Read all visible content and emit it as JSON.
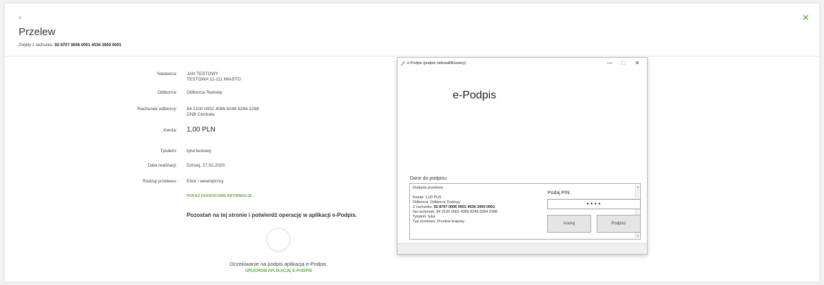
{
  "header": {
    "back_icon": "chevron-left-icon",
    "close_icon": "close-icon",
    "title": "Przelew",
    "sub_prefix": "Zwykły z rachunku",
    "sub_account": "92 8707 0006 0001 4036 3000 0001"
  },
  "details": {
    "nadawca_label": "Nadawca:",
    "nadawca_line1": "JAN TESTOWY",
    "nadawca_line2": "TESTOWA 11-111 MIASTO",
    "odbiorca_label": "Odbiorca:",
    "odbiorca_value": "Odbiorca Testowy",
    "rachunek_label": "Rachunek odbiorcy:",
    "rachunek_line1": "84 2100 0002 4086 8249 8284 2288",
    "rachunek_line2": "DNB Centrala",
    "kwota_label": "Kwota:",
    "kwota_value": "1,00 PLN",
    "tytul_label": "Tytułem:",
    "tytul_value": "tytuł testowy",
    "data_label": "Data realizacji:",
    "data_value": "Dzisiaj, 27.02.2020",
    "rodzaj_label": "Rodzaj przelewu:",
    "rodzaj_value": "Elixir i wewnętrzny",
    "more_link": "POKAŻ DODATKOWE INFORMACJE",
    "confirm_text": "Pozostań na tej stronie i potwierdź operację w aplikacji e-Podpis.",
    "waiting_text": "Oczekiwanie na podpis aplikacją e-Podpis.",
    "launch_link": "URUCHOM APLIKACJĘ E-PODPIS"
  },
  "dialog": {
    "title": "e-Podpis (podpis niekwalifikowany)",
    "minimize": "—",
    "maximize": "☐",
    "close": "✕",
    "heading": "e-Podpis",
    "data_label": "Dane do podpisu:",
    "line_1": "Dodanie przelewu",
    "line_2": "Kwota: 1,00 PLN",
    "line_3": "Odbiorca:  Odbiorca Testowy",
    "line_4_label": "Z rachunku:",
    "line_4_value": "92 8707 0006 0001 4036 3000 0001",
    "line_5": "Na rachunek: 84 2100 0002 4086 8249 8284 2288",
    "line_6": "Tytułem: tytuł",
    "line_7": "Typ przelewu: Przelew krajowy",
    "pin_label": "Podaj PIN:",
    "pin_value": "••••",
    "cancel_label": "Anuluj",
    "sign_label": "Podpisz"
  },
  "colors": {
    "accent": "#5bab3b"
  }
}
